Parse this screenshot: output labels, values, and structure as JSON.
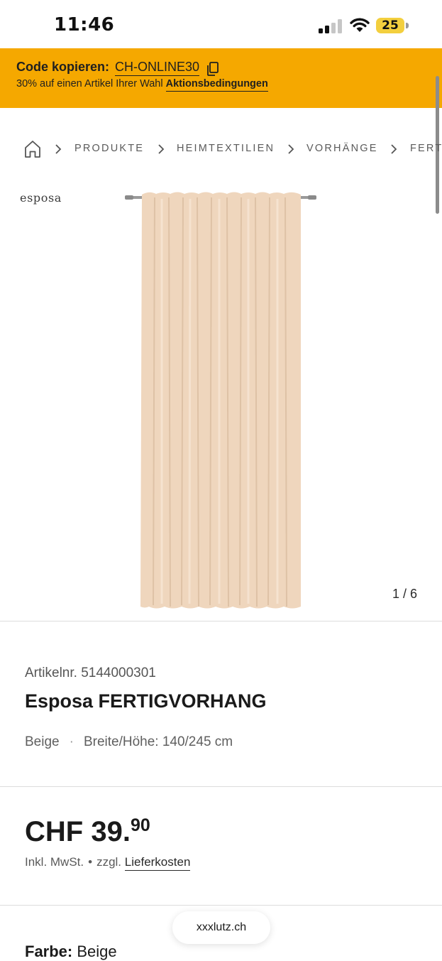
{
  "status_bar": {
    "time": "11:46",
    "battery_level": "25"
  },
  "promo": {
    "label": "Code kopieren:",
    "code": "CH-ONLINE30",
    "description": "30% auf einen Artikel Ihrer Wahl",
    "conditions_link": "Aktionsbedingungen",
    "background_color": "#f5a800"
  },
  "breadcrumb": {
    "items": [
      "PRODUKTE",
      "HEIMTEXTILIEN",
      "VORHÄNGE",
      "FERT"
    ]
  },
  "gallery": {
    "brand": "esposa",
    "counter": "1 / 6"
  },
  "product": {
    "article_nr": "Artikelnr. 5144000301",
    "title": "Esposa FERTIGVORHANG",
    "color": "Beige",
    "separator": "·",
    "dimensions": "Breite/Höhe: 140/245 cm"
  },
  "price": {
    "main": "CHF 39.",
    "cents": "90",
    "tax_note": "Inkl. MwSt.",
    "bullet": "•",
    "shipping_prefix": "zzgl.",
    "shipping_link": "Lieferkosten"
  },
  "color_selector": {
    "label": "Farbe:",
    "value": "Beige"
  },
  "browser": {
    "url": "xxxlutz.ch"
  }
}
